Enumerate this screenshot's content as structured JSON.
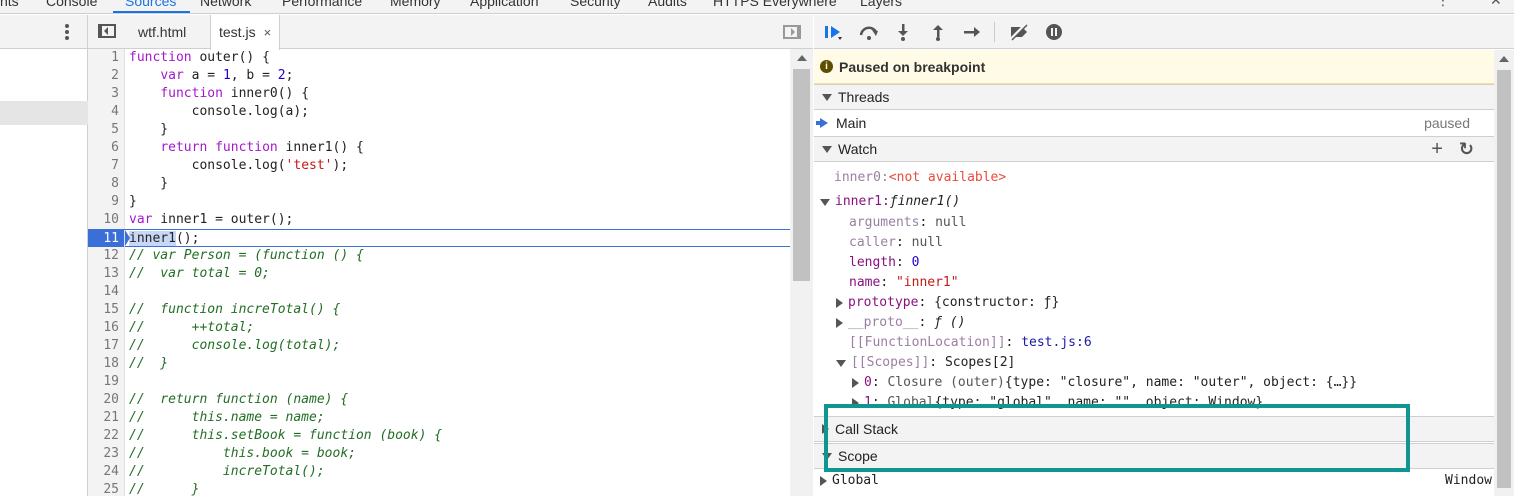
{
  "devtools_tabs": [
    "nts",
    "Console",
    "Sources",
    "Network",
    "Performance",
    "Memory",
    "Application",
    "Security",
    "Audits",
    "HTTPS Everywhere",
    "Layers"
  ],
  "active_tab": "Sources",
  "editor": {
    "tabs": [
      {
        "label": "wtf.html",
        "active": false
      },
      {
        "label": "test.js",
        "active": true,
        "close": "×"
      }
    ],
    "execution_line": 11
  },
  "debugger": {
    "paused_message": "Paused on breakpoint",
    "threads_header": "Threads",
    "thread_name": "Main",
    "thread_status": "paused",
    "watch_header": "Watch",
    "watch_add": "+",
    "watch_refresh": "↻",
    "watch": {
      "inner0_key": "inner0:",
      "inner0_val": "<not available>",
      "inner1_key": "inner1:",
      "inner1_f": "ƒ",
      "inner1_name": "inner1()",
      "arguments_key": "arguments",
      "arguments_val": "null",
      "caller_key": "caller",
      "caller_val": "null",
      "length_key": "length",
      "length_val": "0",
      "name_key": "name",
      "name_val": "\"inner1\"",
      "prototype_key": "prototype",
      "prototype_val": "{constructor: ƒ}",
      "proto_key": "__proto__",
      "proto_val": "ƒ ()",
      "funcloc_key": "[[FunctionLocation]]",
      "funcloc_val": "test.js:6",
      "scopes_key": "[[Scopes]]",
      "scopes_val": "Scopes[2]",
      "scope0_idx": "0",
      "scope0_type": "Closure (outer)",
      "scope0_obj": "{type: \"closure\", name: \"outer\", object: {…}}",
      "scope1_idx": "1",
      "scope1_type": "Global",
      "scope1_obj": "{type: \"global\", name: \"\", object: Window}"
    },
    "callstack_header": "Call Stack",
    "scope_header": "Scope",
    "global_label": "Global",
    "global_value": "Window"
  },
  "colors": {
    "accent": "#1a73e8",
    "exec_line": "#3b6fd8",
    "highlight_box": "#0f9690",
    "paused_bg": "#fffbe6"
  }
}
